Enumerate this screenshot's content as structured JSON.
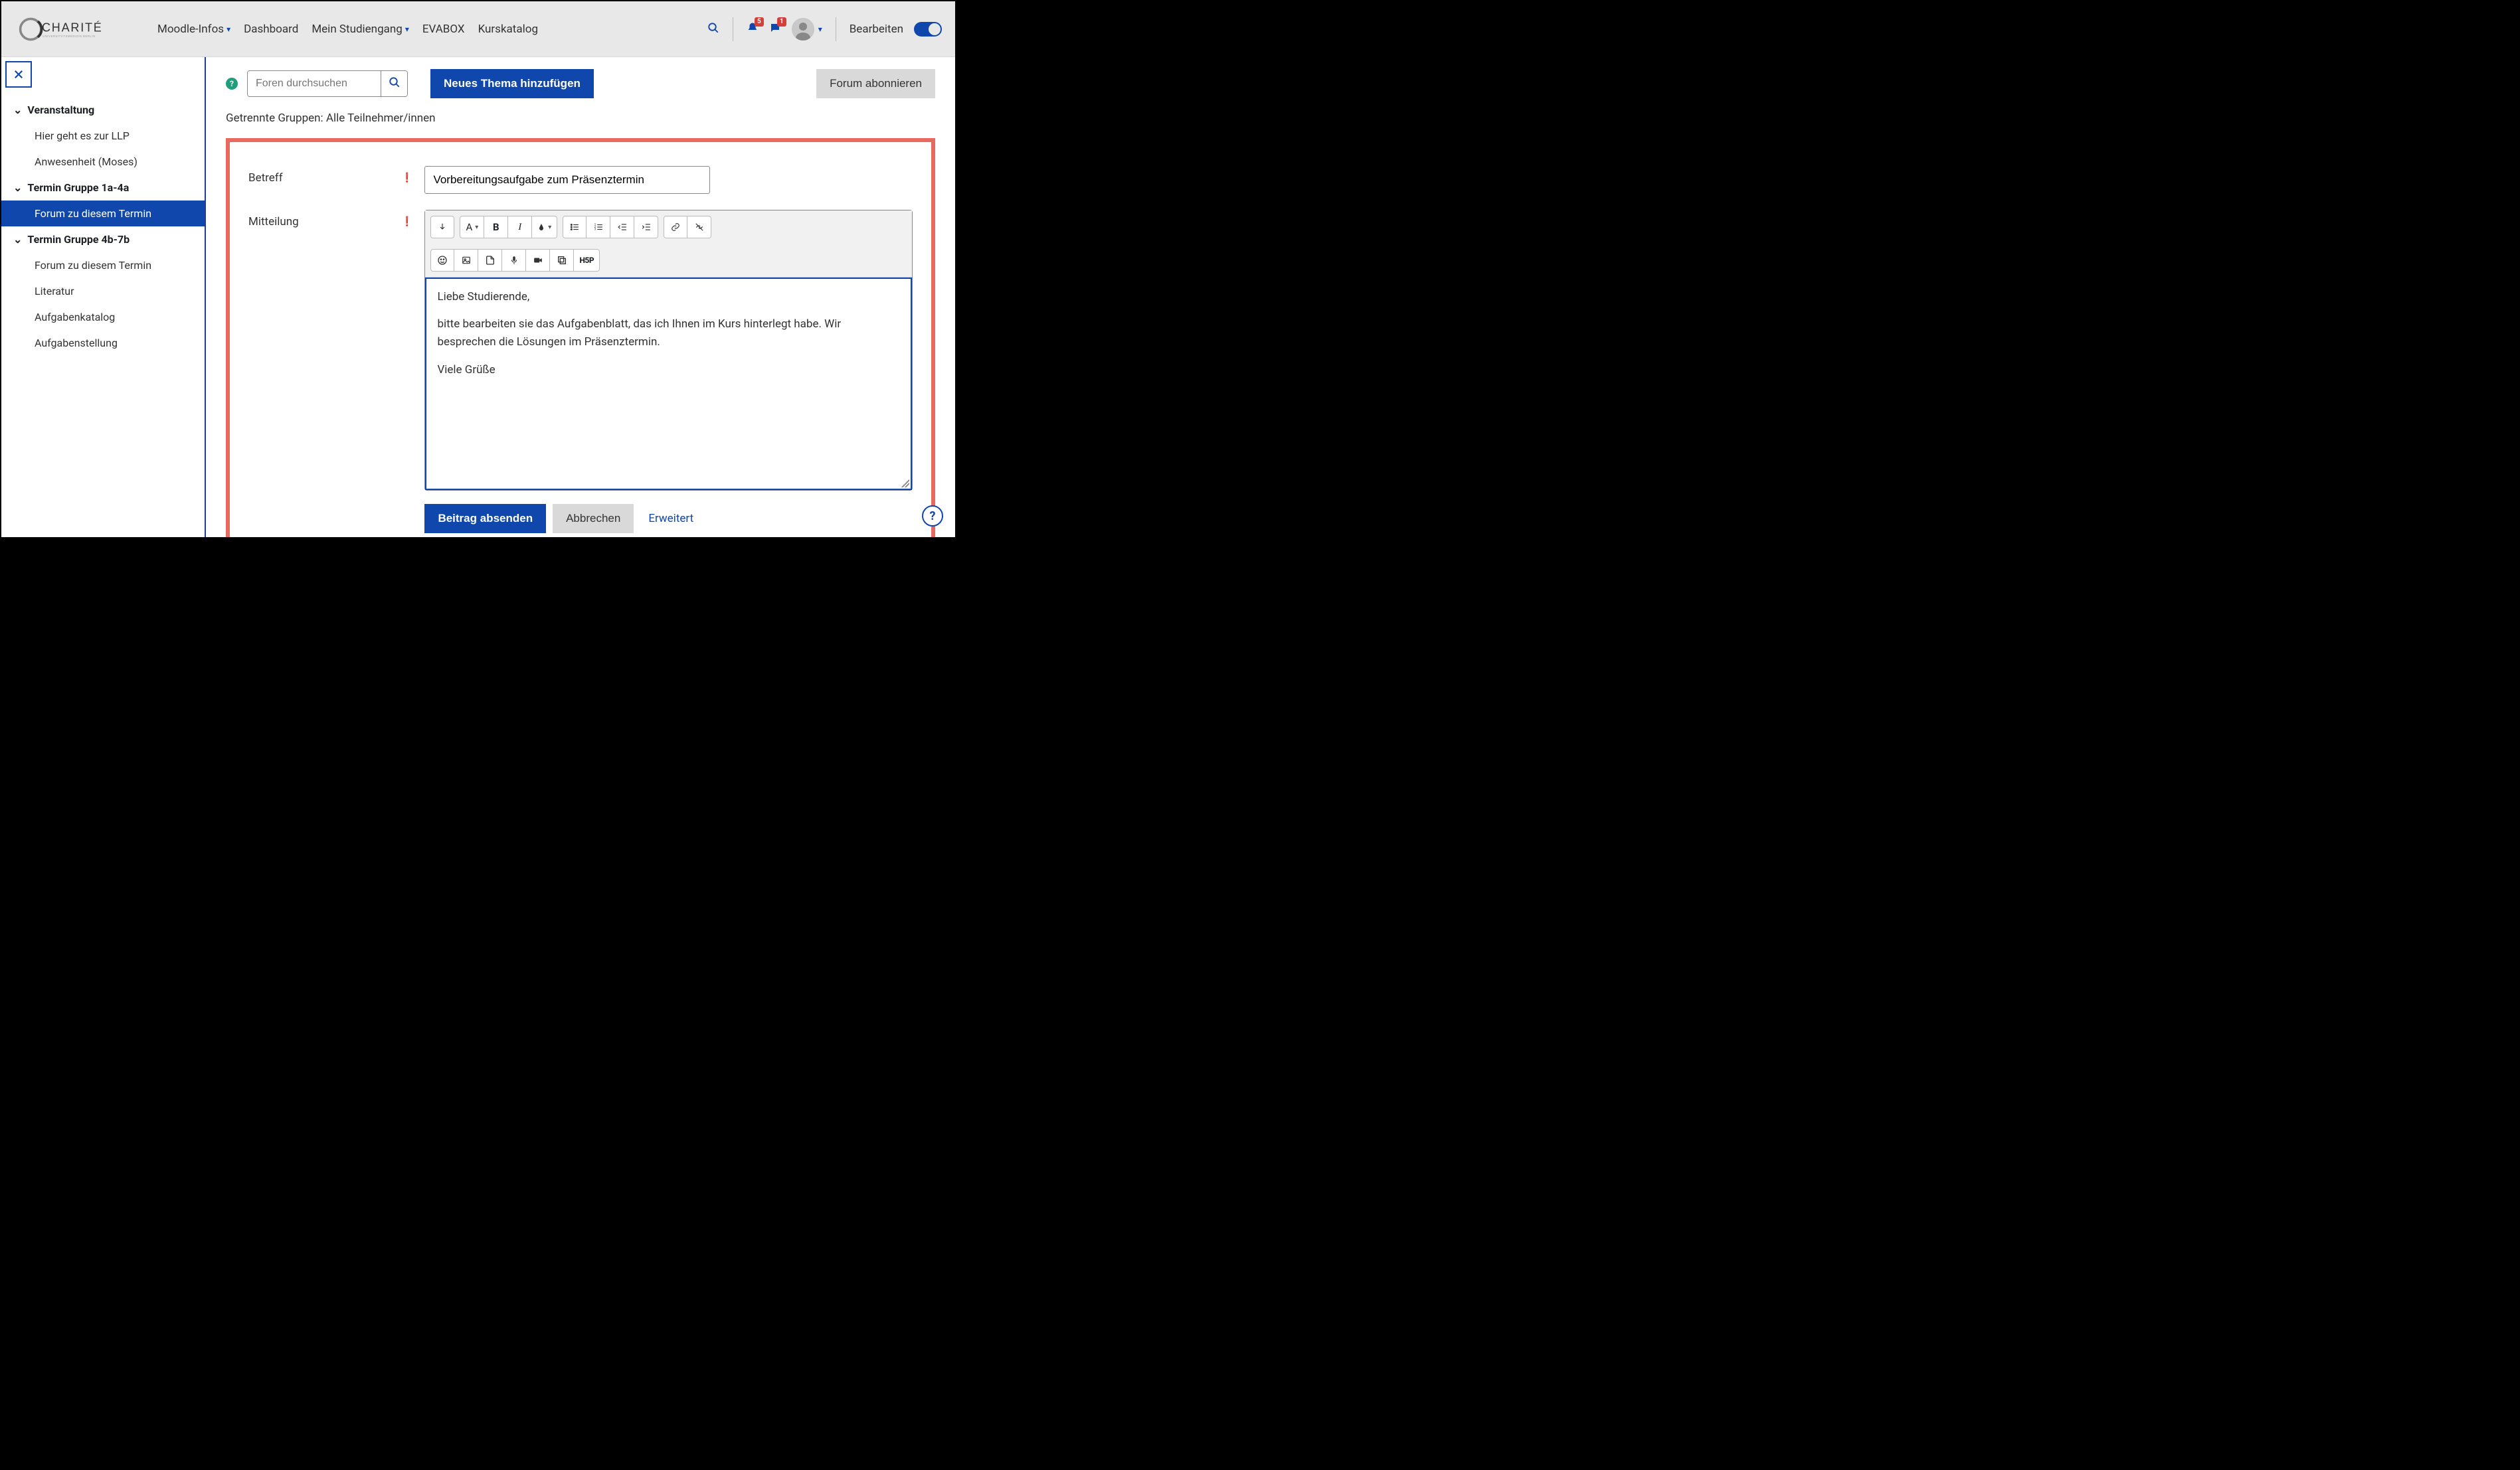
{
  "header": {
    "brand": "CHARITÉ",
    "brand_sub": "UNIVERSITÄTSMEDIZIN BERLIN",
    "nav": {
      "moodle_infos": "Moodle-Infos",
      "dashboard": "Dashboard",
      "mein_studiengang": "Mein Studiengang",
      "evabox": "EVABOX",
      "kurskatalog": "Kurskatalog"
    },
    "badges": {
      "notifications": "5",
      "messages": "1"
    },
    "edit_label": "Bearbeiten"
  },
  "sidebar": {
    "section1": {
      "title": "Veranstaltung",
      "items": [
        "Hier geht es zur LLP",
        "Anwesenheit (Moses)"
      ]
    },
    "section2": {
      "title": "Termin Gruppe 1a-4a",
      "items": [
        "Forum zu diesem Termin"
      ]
    },
    "section3": {
      "title": "Termin Gruppe 4b-7b",
      "items": [
        "Forum zu diesem Termin",
        "Literatur",
        "Aufgabenkatalog",
        "Aufgabenstellung"
      ]
    }
  },
  "toolbar": {
    "search_placeholder": "Foren durchsuchen",
    "new_topic": "Neues Thema hinzufügen",
    "subscribe": "Forum abonnieren"
  },
  "group_line": "Getrennte Gruppen: Alle Teilnehmer/innen",
  "form": {
    "subject_label": "Betreff",
    "subject_value": "Vorbereitungsaufgabe zum Präsenztermin",
    "message_label": "Mitteilung",
    "message": {
      "p1": "Liebe Studierende,",
      "p2": "bitte bearbeiten sie das Aufgabenblatt, das ich Ihnen im Kurs hinterlegt habe. Wir besprechen die Lösungen im Präsenztermin.",
      "p3": "Viele Grüße"
    },
    "submit": "Beitrag absenden",
    "cancel": "Abbrechen",
    "advanced": "Erweitert"
  },
  "icons": {
    "h5p": "H5P"
  }
}
